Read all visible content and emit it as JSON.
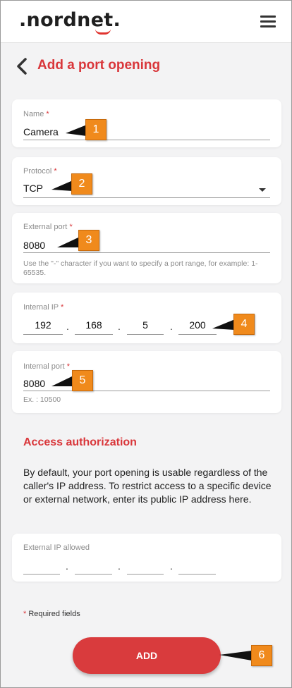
{
  "header": {
    "logo": ".nordnet.",
    "menu_icon": "hamburger-menu-icon"
  },
  "page": {
    "back_icon": "chevron-left-icon",
    "title": "Add a port opening"
  },
  "form": {
    "name": {
      "label": "Name",
      "required_mark": "*",
      "value": "Camera"
    },
    "protocol": {
      "label": "Protocol",
      "required_mark": "*",
      "value": "TCP",
      "dropdown_icon": "caret-down-icon"
    },
    "external_port": {
      "label": "External port",
      "required_mark": "*",
      "value": "8080",
      "hint": "Use the \"-\" character if you want to specify a port range, for example: 1-65535."
    },
    "internal_ip": {
      "label": "Internal IP",
      "required_mark": "*",
      "segments": [
        "192",
        "168",
        "5",
        "200"
      ],
      "separator": "."
    },
    "internal_port": {
      "label": "Internal port",
      "required_mark": "*",
      "value": "8080",
      "hint": "Ex. : 10500"
    }
  },
  "access": {
    "title": "Access authorization",
    "description": "By default, your port opening is usable regardless of the caller's IP address. To restrict access to a specific device or external network, enter its public IP address here.",
    "external_ip": {
      "label": "External IP allowed",
      "segments": [
        "",
        "",
        "",
        ""
      ],
      "separator": "."
    }
  },
  "footer": {
    "required_mark": "*",
    "required_note": "Required fields",
    "add_label": "ADD"
  },
  "callouts": [
    "1",
    "2",
    "3",
    "4",
    "5",
    "6"
  ],
  "colors": {
    "accent": "#d9363a",
    "button": "#d93b3d",
    "callout": "#f08a1c",
    "background": "#f3f3f4"
  }
}
